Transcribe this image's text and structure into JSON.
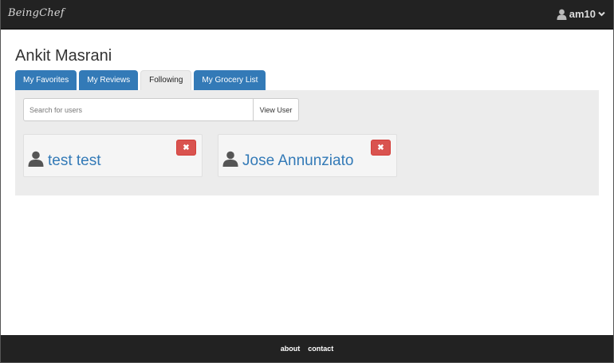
{
  "navbar": {
    "brand": "BeingChef",
    "user": "am10"
  },
  "profile": {
    "name": "Ankit Masrani"
  },
  "tabs": [
    {
      "label": "My Favorites"
    },
    {
      "label": "My Reviews"
    },
    {
      "label": "Following",
      "active": true
    },
    {
      "label": "My Grocery List"
    }
  ],
  "search": {
    "placeholder": "Search for users",
    "value": "",
    "button_label": "View User"
  },
  "following": [
    {
      "name": "test test",
      "remove_glyph": "✖"
    },
    {
      "name": "Jose Annunziato",
      "remove_glyph": "✖"
    }
  ],
  "footer": {
    "links": [
      {
        "label": "about"
      },
      {
        "label": "contact"
      }
    ]
  },
  "colors": {
    "navbar_bg": "#222222",
    "tab_primary": "#337ab7",
    "link": "#337ab7",
    "danger": "#d9534f",
    "panel_bg": "#ececec"
  },
  "icons": {
    "user": "user-icon",
    "caret": "chevron-down-icon",
    "remove": "close-icon"
  }
}
